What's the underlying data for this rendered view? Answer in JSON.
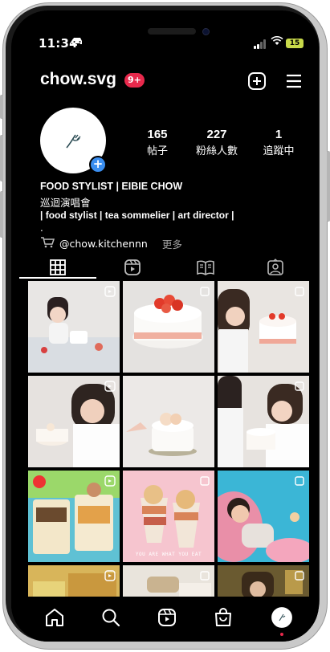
{
  "status_bar": {
    "time": "11:34",
    "battery": "15"
  },
  "header": {
    "username": "chow.svg",
    "notifications": "9+"
  },
  "profile": {
    "stats": [
      {
        "value": "165",
        "label": "帖子"
      },
      {
        "value": "227",
        "label": "粉絲人數"
      },
      {
        "value": "1",
        "label": "追蹤中"
      }
    ],
    "bio": {
      "name": "FOOD STYLIST | EIBIE CHOW",
      "line1": "巡迴演唱會",
      "line2": "| food stylist | tea sommelier | art director |",
      "line3": ".",
      "link": "@chow.kitchennn",
      "more": "更多"
    }
  },
  "grid_caption": "YOU ARE WHAT YOU EAT",
  "colors": {
    "accent": "#3a8ef0",
    "badge": "#e8294c",
    "background": "#000000"
  }
}
